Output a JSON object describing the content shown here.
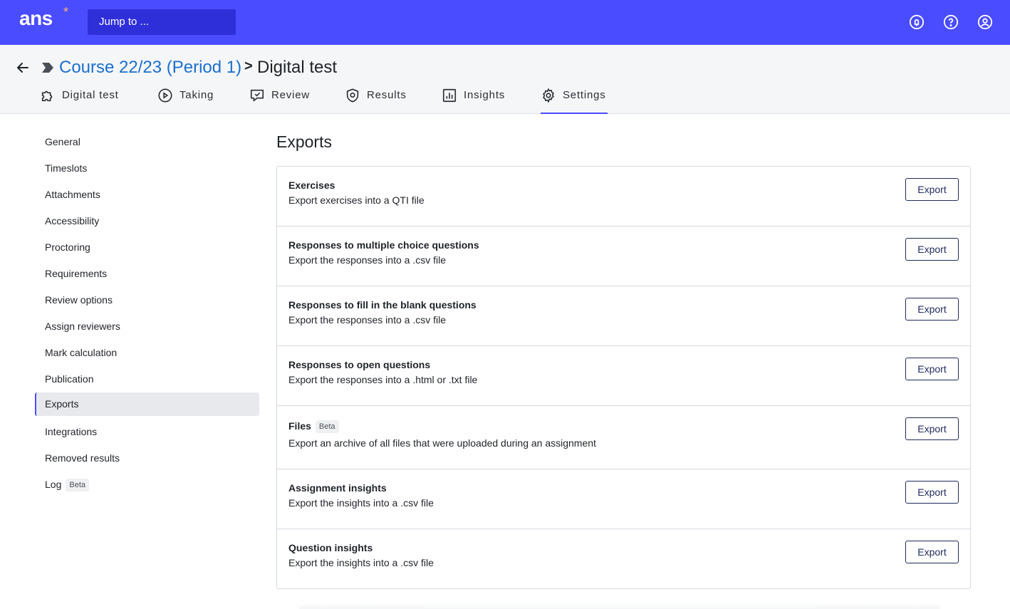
{
  "topbar": {
    "logo": "ans",
    "logo_star": "*",
    "jump_placeholder": "Jump to ...",
    "icons": [
      "bell-icon",
      "help-icon",
      "user-icon"
    ]
  },
  "breadcrumb": {
    "course": "Course 22/23 (Period 1)",
    "separator": ">",
    "title": "Digital test"
  },
  "tabs": [
    {
      "label": "Digital test",
      "icon": "puzzle-icon"
    },
    {
      "label": "Taking",
      "icon": "play-icon"
    },
    {
      "label": "Review",
      "icon": "review-icon"
    },
    {
      "label": "Results",
      "icon": "shield-icon"
    },
    {
      "label": "Insights",
      "icon": "chart-icon"
    },
    {
      "label": "Settings",
      "icon": "gear-icon",
      "active": true
    }
  ],
  "sidebar": {
    "items": [
      {
        "label": "General"
      },
      {
        "label": "Timeslots"
      },
      {
        "label": "Attachments"
      },
      {
        "label": "Accessibility"
      },
      {
        "label": "Proctoring"
      },
      {
        "label": "Requirements"
      },
      {
        "label": "Review options"
      },
      {
        "label": "Assign reviewers"
      },
      {
        "label": "Mark calculation"
      },
      {
        "label": "Publication"
      },
      {
        "label": "Exports",
        "active": true
      },
      {
        "label": "Integrations"
      },
      {
        "label": "Removed results"
      },
      {
        "label": "Log",
        "badge": "Beta"
      }
    ]
  },
  "main": {
    "title": "Exports",
    "export_label": "Export",
    "rows": [
      {
        "title": "Exercises",
        "desc": "Export exercises into a QTI file"
      },
      {
        "title": "Responses to multiple choice questions",
        "desc": "Export the responses into a .csv file"
      },
      {
        "title": "Responses to fill in the blank questions",
        "desc": "Export the responses into a .csv file"
      },
      {
        "title": "Responses to open questions",
        "desc": "Export the responses into a .html or .txt file"
      },
      {
        "title": "Files",
        "badge": "Beta",
        "desc": "Export an archive of all files that were uploaded during an assignment"
      },
      {
        "title": "Assignment insights",
        "desc": "Export the insights into a .csv file"
      },
      {
        "title": "Question insights",
        "desc": "Export the insights into a .csv file"
      }
    ]
  },
  "colors": {
    "brand": "#4a4cff",
    "link": "#1a6fce",
    "button_border": "#1f2a5c"
  }
}
